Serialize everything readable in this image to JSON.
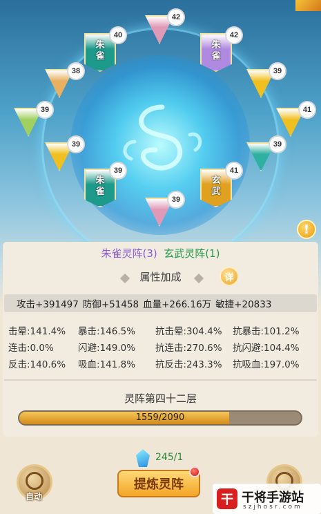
{
  "formations": {
    "f1": "朱雀灵阵(3)",
    "f2": "玄武灵阵(1)"
  },
  "nodes": [
    {
      "level": "42",
      "label": "",
      "color": "#e09ab8"
    },
    {
      "level": "40",
      "label": "朱雀",
      "color": "#1e9a8a"
    },
    {
      "level": "42",
      "label": "朱雀",
      "color": "#b08ae0"
    },
    {
      "level": "38",
      "label": "",
      "color": "#e8b060"
    },
    {
      "level": "39",
      "label": "",
      "color": "#f0c020"
    },
    {
      "level": "39",
      "label": "",
      "color": "#a0d060"
    },
    {
      "level": "41",
      "label": "",
      "color": "#f0c020"
    },
    {
      "level": "39",
      "label": "",
      "color": "#f0c020"
    },
    {
      "level": "39",
      "label": "",
      "color": "#30b0a0"
    },
    {
      "level": "39",
      "label": "朱雀",
      "color": "#1e9a8a"
    },
    {
      "level": "41",
      "label": "玄武",
      "color": "#e0a020"
    },
    {
      "level": "39",
      "label": "",
      "color": "#e09ab8"
    }
  ],
  "alert_icon": "!",
  "attr": {
    "title": "属性加成",
    "detail": "详"
  },
  "main_stats": [
    "攻击+391497",
    "防御+51458",
    "血量+266.16万",
    "敏捷+20833"
  ],
  "stats_grid": [
    [
      "击晕:141.4%",
      "暴击:146.5%",
      "抗击晕:304.4%",
      "抗暴击:101.2%"
    ],
    [
      "连击:0.0%",
      "闪避:149.0%",
      "抗连击:270.6%",
      "抗闪避:104.4%"
    ],
    [
      "反击:140.6%",
      "吸血:141.8%",
      "抗反击:243.3%",
      "抗吸血:197.0%"
    ]
  ],
  "layer": {
    "title": "灵阵第四十二层",
    "progress_text": "1559/2090",
    "progress": 0.746
  },
  "gems": {
    "count": "245/1",
    "icon": "gem-icon"
  },
  "buttons": {
    "auto": "自动",
    "refine": "提炼灵阵"
  },
  "watermark": {
    "logo": "干",
    "text": "干将手游站",
    "sub": "szjhosr.com"
  }
}
